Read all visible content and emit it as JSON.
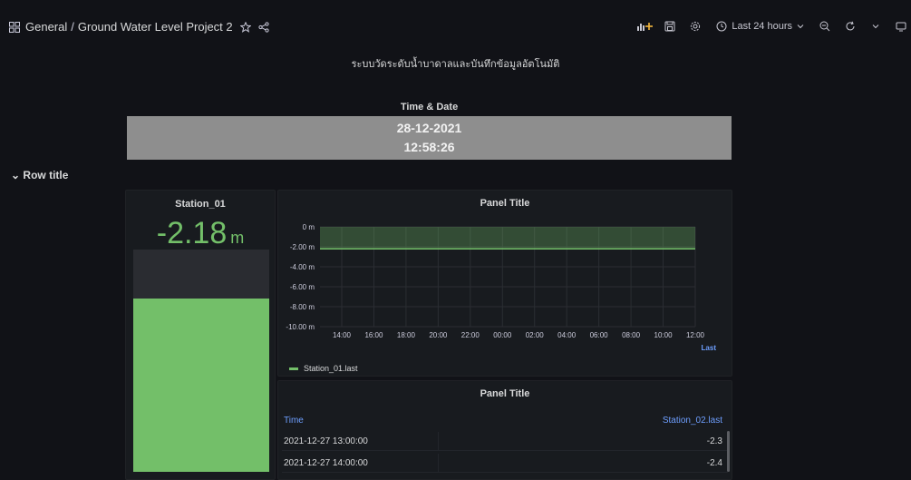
{
  "header": {
    "folder": "General",
    "separator": "/",
    "dashboard_title": "Ground Water Level Project 2"
  },
  "toolbar": {
    "time_range": "Last 24 hours"
  },
  "dashboard_text": "ระบบวัดระดับน้ำบาดาลและบันทึกข้อมูลอัตโนมัติ",
  "clock_panel": {
    "title": "Time & Date",
    "date": "28-12-2021",
    "time": "12:58:26"
  },
  "row": {
    "title": "Row title"
  },
  "stat_panel": {
    "title": "Station_01",
    "value": "-2.18",
    "unit": "m",
    "fill_fraction": 0.78
  },
  "graph_panel": {
    "title": "Panel Title",
    "legend_label": "Station_01.last",
    "last_label": "Last"
  },
  "table_panel": {
    "title": "Panel Title",
    "columns": [
      "Time",
      "Station_02.last"
    ],
    "rows": [
      [
        "2021-12-27 13:00:00",
        "-2.3"
      ],
      [
        "2021-12-27 14:00:00",
        "-2.4"
      ]
    ]
  },
  "chart_data": {
    "type": "area",
    "x": [
      "14:00",
      "16:00",
      "18:00",
      "20:00",
      "22:00",
      "00:00",
      "02:00",
      "04:00",
      "06:00",
      "08:00",
      "10:00",
      "12:00"
    ],
    "series": [
      {
        "name": "Station_01.last",
        "values": [
          -2.2,
          -2.2,
          -2.2,
          -2.2,
          -2.2,
          -2.2,
          -2.2,
          -2.2,
          -2.2,
          -2.2,
          -2.2,
          -2.2
        ]
      }
    ],
    "y_ticks": [
      "0 m",
      "-2.00 m",
      "-4.00 m",
      "-6.00 m",
      "-8.00 m",
      "-10.00 m"
    ],
    "ylim": [
      -10,
      0
    ],
    "grid": true,
    "color": "#73bf69"
  }
}
